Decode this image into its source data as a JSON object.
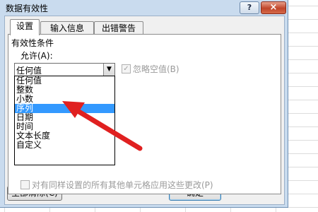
{
  "window": {
    "title": "数据有效性",
    "help_label": "?",
    "close_label": "×"
  },
  "tabs": [
    {
      "label": "设置"
    },
    {
      "label": "输入信息"
    },
    {
      "label": "出错警告"
    }
  ],
  "settings": {
    "group_label": "有效性条件",
    "allow_label": "允许(A):",
    "allow_value": "任何值",
    "ignore_blank_label": "忽略空值(B)",
    "ignore_blank_checked": true,
    "options": [
      {
        "label": "任何值"
      },
      {
        "label": "整数"
      },
      {
        "label": "小数"
      },
      {
        "label": "序列"
      },
      {
        "label": "日期"
      },
      {
        "label": "时间"
      },
      {
        "label": "文本长度"
      },
      {
        "label": "自定义"
      }
    ],
    "highlighted_option": "序列",
    "apply_all_label": "对有同样设置的所有其他单元格应用这些更改(P)"
  },
  "footer": {
    "clear_all_label": "全部清除(C)",
    "ok_label": "确定"
  },
  "colors": {
    "frame": "#c9dbee",
    "highlight": "#3399ff",
    "annotation_arrow": "#e02020"
  }
}
